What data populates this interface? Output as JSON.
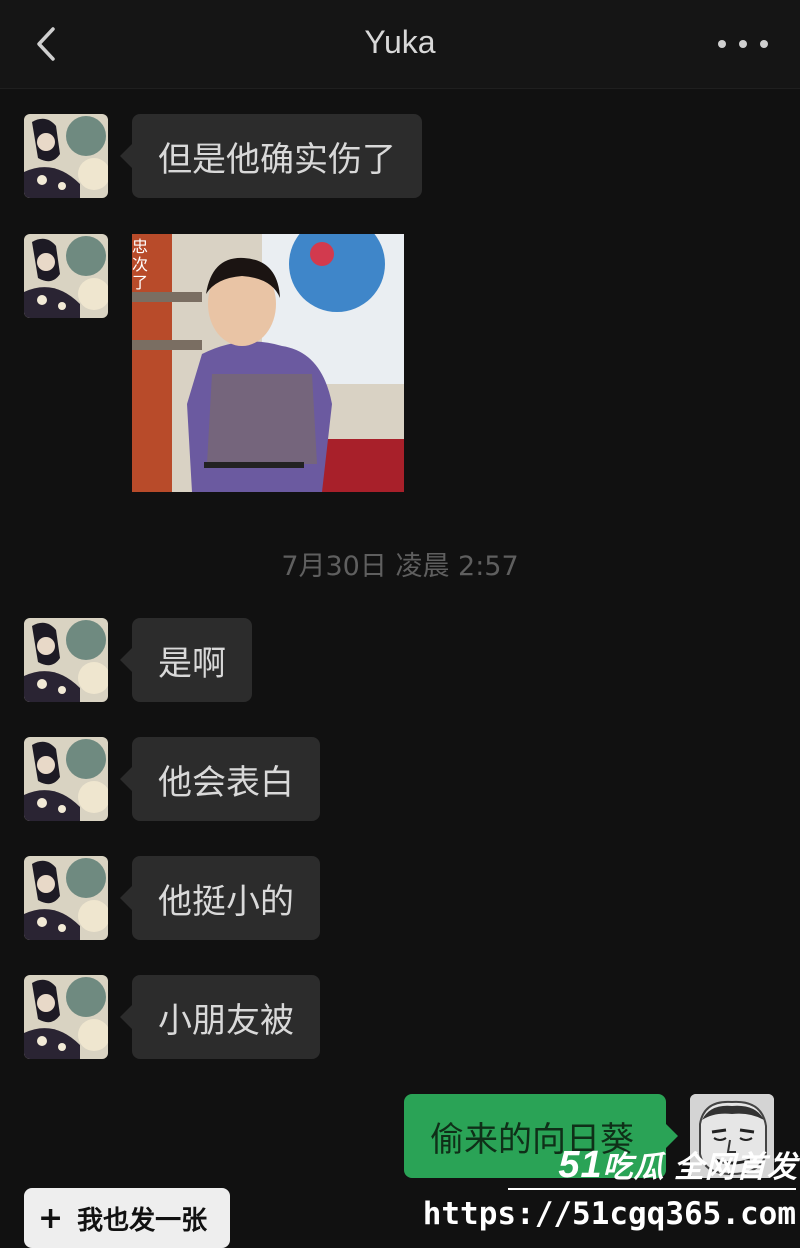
{
  "header": {
    "title": "Yuka",
    "back_icon": "chevron-left-icon",
    "more_icon": "ellipsis-icon"
  },
  "messages": [
    {
      "type": "text",
      "sender": "Yuka",
      "text": "但是他确实伤了"
    },
    {
      "type": "image",
      "sender": "Yuka",
      "caption_fragment": "忠\n次\n了"
    },
    {
      "type": "timestamp",
      "text": "7月30日 凌晨 2:57"
    },
    {
      "type": "text",
      "sender": "Yuka",
      "text": "是啊"
    },
    {
      "type": "text",
      "sender": "Yuka",
      "text": "他会表白"
    },
    {
      "type": "text",
      "sender": "Yuka",
      "text": "他挺小的"
    },
    {
      "type": "text",
      "sender": "Yuka",
      "text": "小朋友被"
    },
    {
      "type": "text",
      "sender": "me",
      "text": "偷来的向日葵"
    }
  ],
  "share_button": {
    "label": "我也发一张",
    "icon": "plus-icon"
  },
  "watermark": {
    "logo_num": "51",
    "logo_text": "吃瓜 全网首发",
    "url": "https://51cgq365.com"
  },
  "colors": {
    "background": "#111111",
    "received_bubble": "#2c2c2c",
    "sent_bubble": "#2aa356"
  }
}
